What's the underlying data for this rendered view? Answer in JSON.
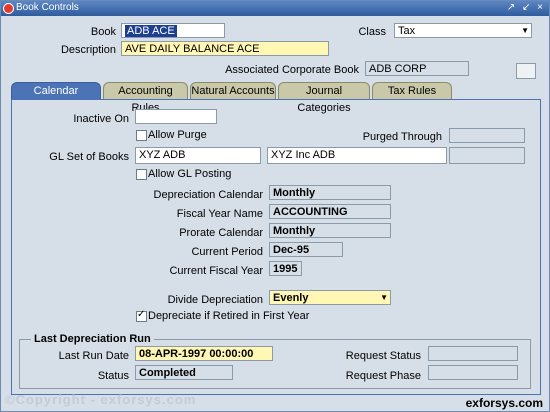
{
  "window": {
    "title": "Book Controls",
    "controls": "↗ ↙ ×"
  },
  "header": {
    "book_label": "Book",
    "book_value": "ADB ACE",
    "class_label": "Class",
    "class_value": "Tax",
    "description_label": "Description",
    "description_value": "AVE DAILY BALANCE ACE",
    "assoc_label": "Associated Corporate Book",
    "assoc_value": "ADB CORP"
  },
  "tabs": [
    {
      "label": "Calendar",
      "active": true
    },
    {
      "label": "Accounting Rules"
    },
    {
      "label": "Natural Accounts"
    },
    {
      "label": "Journal Categories"
    },
    {
      "label": "Tax Rules"
    }
  ],
  "calendar": {
    "inactive_on_label": "Inactive On",
    "inactive_on_value": "",
    "allow_purge_label": "Allow Purge",
    "allow_purge_checked": false,
    "purged_through_label": "Purged Through",
    "purged_through_value": "",
    "gl_set_label": "GL Set of Books",
    "gl_set_value": "XYZ ADB",
    "gl_set_desc": "XYZ Inc ADB",
    "allow_gl_posting_label": "Allow GL Posting",
    "allow_gl_posting_checked": false,
    "dep_calendar_label": "Depreciation Calendar",
    "dep_calendar_value": "Monthly",
    "fiscal_year_name_label": "Fiscal Year Name",
    "fiscal_year_name_value": "ACCOUNTING",
    "prorate_calendar_label": "Prorate Calendar",
    "prorate_calendar_value": "Monthly",
    "current_period_label": "Current Period",
    "current_period_value": "Dec-95",
    "current_fiscal_year_label": "Current Fiscal Year",
    "current_fiscal_year_value": "1995",
    "divide_dep_label": "Divide Depreciation",
    "divide_dep_value": "Evenly",
    "dep_retired_label": "Depreciate if Retired in First Year",
    "dep_retired_checked": true
  },
  "last_run": {
    "title": "Last Depreciation Run",
    "last_run_date_label": "Last Run Date",
    "last_run_date_value": "08-APR-1997 00:00:00",
    "status_label": "Status",
    "status_value": "Completed",
    "request_status_label": "Request Status",
    "request_status_value": "",
    "request_phase_label": "Request Phase",
    "request_phase_value": ""
  },
  "footer": {
    "copyright": "©Copyright - exforsys.com",
    "brand": "exforsys.com"
  }
}
